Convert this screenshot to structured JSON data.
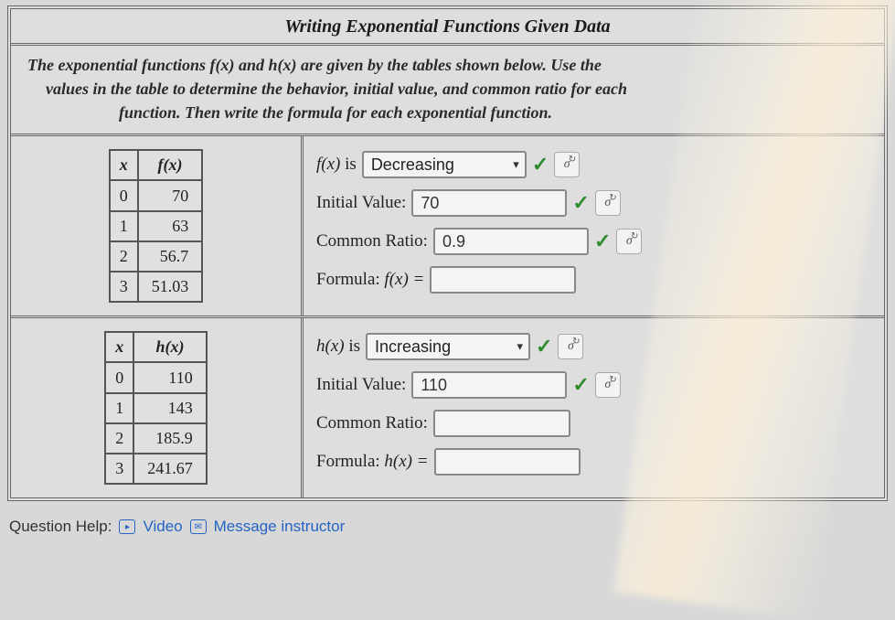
{
  "title": "Writing Exponential Functions Given Data",
  "instructions": {
    "l1": "The exponential functions f(x) and h(x) are given by the tables shown below. Use the",
    "l2": "values in the table to determine the behavior, initial value, and common ratio for each",
    "l3": "function. Then write the formula for each exponential function."
  },
  "f": {
    "header_x": "x",
    "header_fx": "f(x)",
    "rows": [
      {
        "x": "0",
        "y": "70"
      },
      {
        "x": "1",
        "y": "63"
      },
      {
        "x": "2",
        "y": "56.7"
      },
      {
        "x": "3",
        "y": "51.03"
      }
    ],
    "behavior_label_pre": "f(x)",
    "behavior_label_is": " is ",
    "behavior_value": "Decreasing",
    "initial_label": "Initial Value: ",
    "initial_value": "70",
    "ratio_label": "Common Ratio: ",
    "ratio_value": "0.9",
    "formula_label": "Formula: ",
    "formula_fn": "f(x) = ",
    "formula_value": ""
  },
  "h": {
    "header_x": "x",
    "header_hx": "h(x)",
    "rows": [
      {
        "x": "0",
        "y": "110"
      },
      {
        "x": "1",
        "y": "143"
      },
      {
        "x": "2",
        "y": "185.9"
      },
      {
        "x": "3",
        "y": "241.67"
      }
    ],
    "behavior_label_pre": "h(x)",
    "behavior_label_is": " is ",
    "behavior_value": "Increasing",
    "initial_label": "Initial Value: ",
    "initial_value": "110",
    "ratio_label": "Common Ratio: ",
    "ratio_value": "",
    "formula_label": "Formula: ",
    "formula_fn": "h(x) = ",
    "formula_value": ""
  },
  "help": {
    "label": "Question Help:",
    "video": "Video",
    "message": "Message instructor"
  },
  "retry_glyph": "σ"
}
